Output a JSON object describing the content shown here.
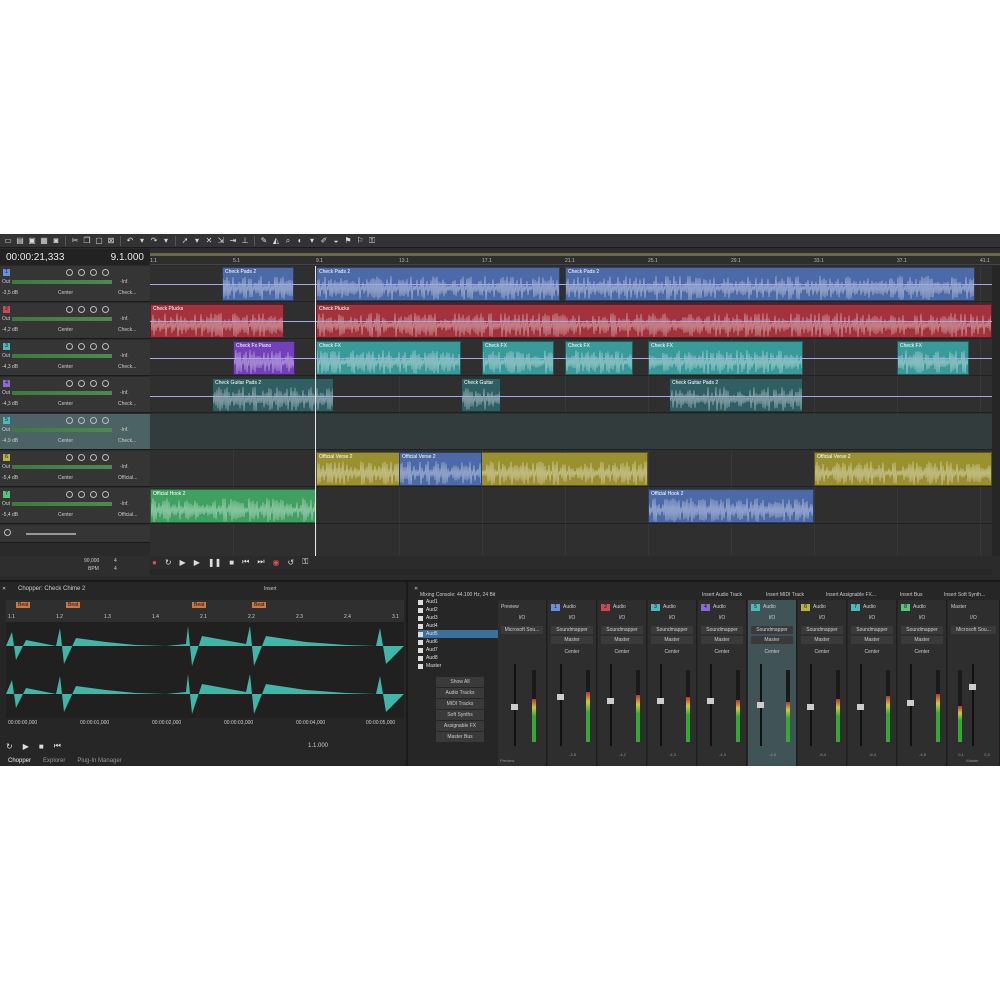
{
  "transport": {
    "time": "00:00:21,333",
    "position": "9.1.000"
  },
  "ruler_ticks": [
    "1.1",
    "5.1",
    "9.1",
    "13.1",
    "17.1",
    "21.1",
    "25.1",
    "29.1",
    "33.1",
    "37.1",
    "41.1"
  ],
  "tracks": [
    {
      "num": "1",
      "color": "#6b8fd8",
      "out": "Out",
      "db": "-3,5 dB",
      "pan": "Center",
      "route": "Check...",
      "inf": "-Inf."
    },
    {
      "num": "2",
      "color": "#c74a55",
      "out": "Out",
      "db": "-4,2 dB",
      "pan": "Center",
      "route": "Check...",
      "inf": "-Inf."
    },
    {
      "num": "3",
      "color": "#4fb8b8",
      "out": "Out",
      "db": "-4,3 dB",
      "pan": "Center",
      "route": "Check...",
      "inf": "-Inf."
    },
    {
      "num": "4",
      "color": "#8a6ad0",
      "out": "Out",
      "db": "-4,3 dB",
      "pan": "Center",
      "route": "Check...",
      "inf": "-Inf."
    },
    {
      "num": "5",
      "color": "#4fb8b8",
      "out": "Out",
      "db": "-4,9 dB",
      "pan": "Center",
      "route": "Check...",
      "inf": "-Inf."
    },
    {
      "num": "6",
      "color": "#b8b04a",
      "out": "Out",
      "db": "-5,4 dB",
      "pan": "Center",
      "route": "Official...",
      "inf": "-Inf."
    },
    {
      "num": "7",
      "color": "#58c37a",
      "out": "Out",
      "db": "-5,4 dB",
      "pan": "Center",
      "route": "Official...",
      "inf": "-Inf."
    }
  ],
  "clips": {
    "t1": "Check Pads 2",
    "t2": "Check Plucks",
    "t3": "Check FX",
    "t3b": "Check Fx Piano",
    "t4": "Check Guitar Pads 2",
    "t4b": "Check Guitar",
    "t6": "Official Verse 2",
    "t7": "Official Hook 2"
  },
  "tempo": {
    "bpm": "90,000",
    "bpm_label": "BPM",
    "sig_top": "4",
    "sig_bottom": "4"
  },
  "chopper": {
    "title": "Chopper: Check Chime 2",
    "insert": "Insert",
    "marker": "Beat",
    "ticks": [
      "1.1",
      "1.2",
      "1.3",
      "1.4",
      "2.1",
      "2.2",
      "2.3",
      "2.4",
      "3.1"
    ],
    "times": [
      "00:00:00,000",
      "00:00:01,000",
      "00:00:02,000",
      "00:00:03,000",
      "00:00:04,000",
      "00:00:05,000"
    ],
    "position": "1.1.000",
    "tabs": [
      "Chopper",
      "Explorer",
      "Plug-In Manager"
    ]
  },
  "mixer": {
    "title": "Mixing Console: 44.100 Hz, 24 Bit",
    "insert_audio": "Insert Audio Track",
    "insert_midi": "Insert MIDI Track",
    "insert_fx": "Insert Assignable FX...",
    "insert_bus": "Insert Bus",
    "insert_synth": "Insert Soft Synth...",
    "list": [
      "Aud1",
      "Aud2",
      "Aud3",
      "Aud4",
      "Aud5",
      "Aud6",
      "Aud7",
      "Aud8",
      "Master"
    ],
    "buttons": [
      "Show All",
      "Audio Tracks",
      "MIDI Tracks",
      "Soft Synths",
      "Assignable FX",
      "Master Bus"
    ],
    "preview": {
      "name": "Preview",
      "io": "I/O",
      "device": "Microsoft Sou...",
      "footer": "Preview"
    },
    "strips": [
      {
        "num": "1",
        "color": "#6b8fd8",
        "name": "Audio",
        "value": "-3,5"
      },
      {
        "num": "2",
        "color": "#c74a55",
        "name": "Audio",
        "value": "-4,2"
      },
      {
        "num": "3",
        "color": "#4fb8b8",
        "name": "Audio",
        "value": "-4,3"
      },
      {
        "num": "4",
        "color": "#8a6ad0",
        "name": "Audio",
        "value": "-4,3"
      },
      {
        "num": "5",
        "color": "#4fb8b8",
        "name": "Audio",
        "value": "-4,9"
      },
      {
        "num": "6",
        "color": "#b8b04a",
        "name": "Audio",
        "value": "-5,4"
      },
      {
        "num": "7",
        "color": "#4fb8b8",
        "name": "Audio",
        "value": "-5,4"
      },
      {
        "num": "8",
        "color": "#58c37a",
        "name": "Audio",
        "value": "-4,5"
      }
    ],
    "strip_io": "I/O",
    "strip_device": "Soundmapper",
    "strip_out": "Master",
    "strip_pan": "Center",
    "master": {
      "name": "Master",
      "io": "I/O",
      "device": "Microsoft Sou...",
      "value_l": "0,1",
      "value_r": "0,3",
      "footer": "Master"
    }
  }
}
